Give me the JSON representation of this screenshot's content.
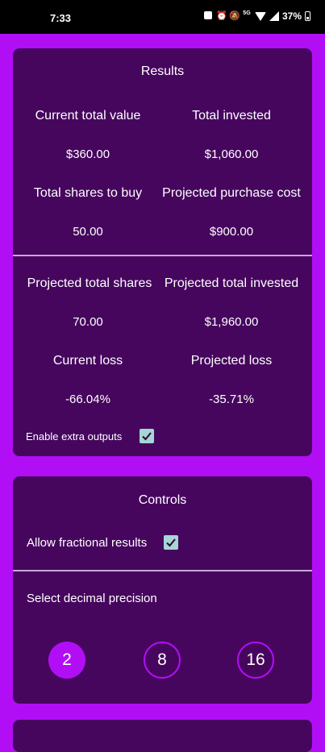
{
  "status_bar": {
    "time": "7:33",
    "battery": "37%",
    "icons": [
      "nfc-icon",
      "alarm-icon",
      "mute-icon",
      "network-icon",
      "wifi-icon",
      "signal-icon",
      "battery-icon"
    ]
  },
  "results": {
    "title": "Results",
    "current_total_value_label": "Current total value",
    "current_total_value": "$360.00",
    "total_invested_label": "Total invested",
    "total_invested": "$1,060.00",
    "total_shares_to_buy_label": "Total shares to buy",
    "total_shares_to_buy": "50.00",
    "projected_purchase_cost_label": "Projected purchase cost",
    "projected_purchase_cost": "$900.00",
    "projected_total_shares_label": "Projected total shares",
    "projected_total_shares": "70.00",
    "projected_total_invested_label": "Projected total invested",
    "projected_total_invested": "$1,960.00",
    "current_loss_label": "Current loss",
    "current_loss": "-66.04%",
    "projected_loss_label": "Projected loss",
    "projected_loss": "-35.71%",
    "enable_extra_outputs_label": "Enable extra outputs",
    "enable_extra_outputs_checked": true
  },
  "controls": {
    "title": "Controls",
    "allow_fractional_label": "Allow fractional results",
    "allow_fractional_checked": true,
    "precision_label": "Select decimal precision",
    "precision_options": [
      "2",
      "8",
      "16"
    ],
    "precision_selected": "2"
  },
  "colors": {
    "background": "#b20ef5",
    "card": "#46065e",
    "checkbox": "#a5d6d4",
    "divider": "#c9a6d6"
  }
}
